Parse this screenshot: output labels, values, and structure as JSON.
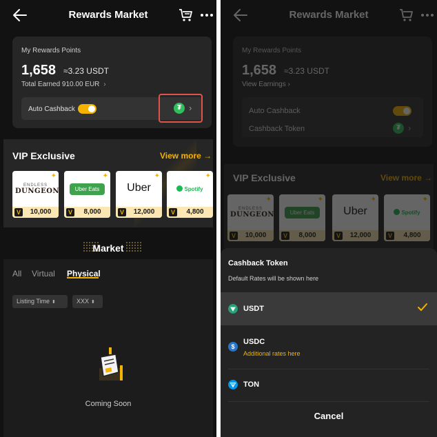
{
  "header": {
    "title": "Rewards Market"
  },
  "points_card": {
    "label": "My Rewards Points",
    "points": "1,658",
    "usdt_equiv": "≈3.23 USDT",
    "total_earned": "Total Earned 910.00 EUR",
    "view_earnings": "View Earnings",
    "auto_cashback_label": "Auto Cashback",
    "auto_cashback_on": true,
    "cashback_token_label": "Cashback Token"
  },
  "vip": {
    "title": "VIP Exclusive",
    "view_more": "View more",
    "tiles": [
      {
        "brand_small": "ENDLESS",
        "brand": "DUNGEON",
        "price": "10,000"
      },
      {
        "brand": "Uber Eats",
        "price": "8,000"
      },
      {
        "brand": "Uber",
        "price": "12,000"
      },
      {
        "brand": "Spotify",
        "price": "4,800"
      }
    ]
  },
  "market": {
    "title": "Market",
    "tabs": [
      "All",
      "Virtual",
      "Physical"
    ],
    "active_tab": "Physical",
    "filters": [
      "Listing Time",
      "XXX"
    ],
    "empty_text": "Coming Soon"
  },
  "cashback_sheet": {
    "title": "Cashback Token",
    "subtitle": "Default Rates will be shown here",
    "options": [
      {
        "name": "USDT",
        "selected": true,
        "note": ""
      },
      {
        "name": "USDC",
        "selected": false,
        "note": "Additional rates here"
      },
      {
        "name": "TON",
        "selected": false,
        "note": ""
      }
    ],
    "cancel": "Cancel"
  },
  "colors": {
    "background": "#121212",
    "card": "#262626",
    "accent": "#f5b300",
    "highlight_box": "#e0544c",
    "tether_green": "#2fbf5b",
    "usdc_blue": "#2775ca",
    "ton_blue": "#0098ea"
  },
  "icons": {
    "back": "arrow-left-icon",
    "cart": "cart-icon",
    "more": "more-dots-icon",
    "tether": "tether-icon",
    "check": "check-icon"
  }
}
